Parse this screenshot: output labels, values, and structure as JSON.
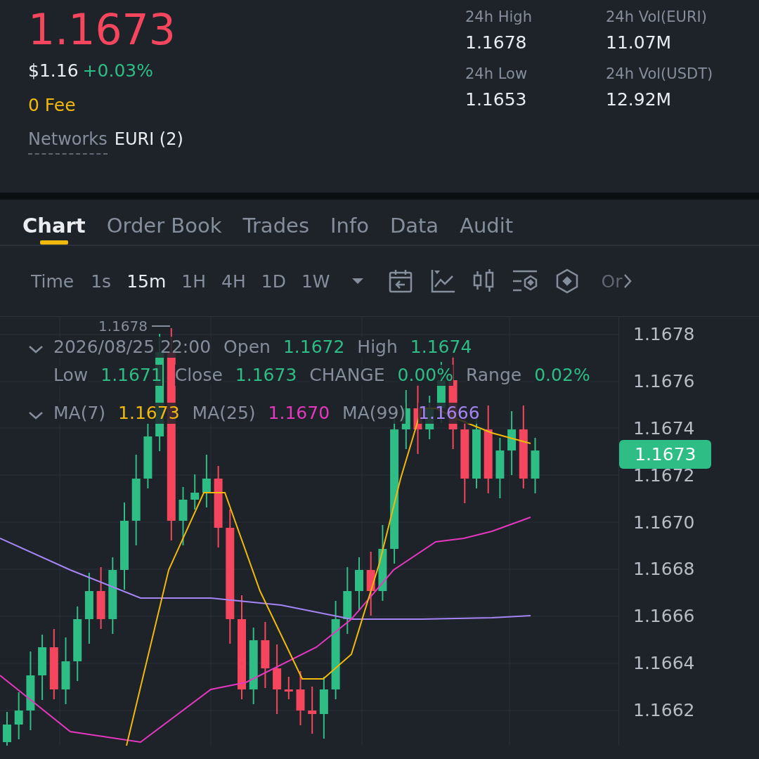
{
  "price": "1.1673",
  "usd_price": "$1.16",
  "change": "+0.03%",
  "fee": "0 Fee",
  "networks": {
    "label": "Networks",
    "value": "EURI (2)"
  },
  "stats": [
    {
      "label": "24h High",
      "value": "1.1678"
    },
    {
      "label": "24h Vol(EURI)",
      "value": "11.07M"
    },
    {
      "label": "24h Low",
      "value": "1.1653"
    },
    {
      "label": "24h Vol(USDT)",
      "value": "12.92M"
    }
  ],
  "tabs": [
    {
      "label": "Chart",
      "selected": true
    },
    {
      "label": "Order Book",
      "selected": false
    },
    {
      "label": "Trades",
      "selected": false
    },
    {
      "label": "Info",
      "selected": false
    },
    {
      "label": "Data",
      "selected": false
    },
    {
      "label": "Audit",
      "selected": false
    }
  ],
  "time_label": "Time",
  "intervals": [
    {
      "label": "1s",
      "selected": false
    },
    {
      "label": "15m",
      "selected": true
    },
    {
      "label": "1H",
      "selected": false
    },
    {
      "label": "4H",
      "selected": false
    },
    {
      "label": "1D",
      "selected": false
    },
    {
      "label": "1W",
      "selected": false
    }
  ],
  "toolbar_more": "Or",
  "ohlc": {
    "date": "2026/08/25 22:00",
    "fields": [
      {
        "label": "Open",
        "value": "1.1672"
      },
      {
        "label": "High",
        "value": "1.1674"
      },
      {
        "label": "Low",
        "value": "1.1671"
      },
      {
        "label": "Close",
        "value": "1.1673"
      },
      {
        "label": "CHANGE",
        "value": "0.00%"
      },
      {
        "label": "Range",
        "value": "0.02%"
      }
    ]
  },
  "ma": [
    {
      "label": "MA(7)",
      "value": "1.1673",
      "color": "#f0b90b"
    },
    {
      "label": "MA(25)",
      "value": "1.1670",
      "color": "#e637bf"
    },
    {
      "label": "MA(99)",
      "value": "1.1666",
      "color": "#a585f5"
    }
  ],
  "high_marker": "1.1678",
  "price_axis": [
    "1.1678",
    "1.1676",
    "1.1674",
    "1.1672",
    "1.1670",
    "1.1668",
    "1.1666",
    "1.1664",
    "1.1662"
  ],
  "current_price_tag": "1.1673"
}
